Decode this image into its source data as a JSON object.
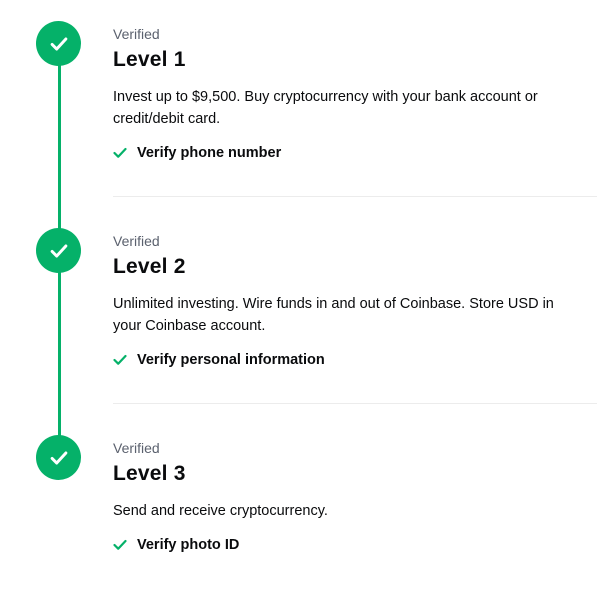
{
  "levels": [
    {
      "status": "Verified",
      "title": "Level 1",
      "description": "Invest up to $9,500. Buy cryptocurrency with your bank account or credit/debit card.",
      "requirement": "Verify phone number"
    },
    {
      "status": "Verified",
      "title": "Level 2",
      "description": "Unlimited investing. Wire funds in and out of Coinbase. Store USD in your Coinbase account.",
      "requirement": "Verify personal information"
    },
    {
      "status": "Verified",
      "title": "Level 3",
      "description": "Send and receive cryptocurrency.",
      "requirement": "Verify photo ID"
    }
  ],
  "colors": {
    "accent": "#05b169",
    "muted_text": "#5b616e",
    "divider": "#ececec"
  },
  "icons": {
    "step_status": "check-circle-icon",
    "requirement_status": "checkmark-icon"
  }
}
